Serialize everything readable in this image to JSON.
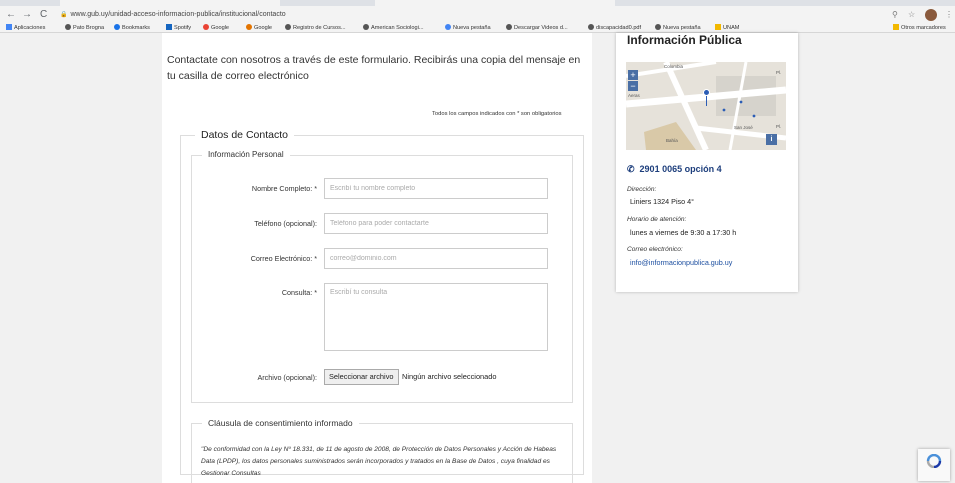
{
  "browser": {
    "url": "www.gub.uy/unidad-acceso-informacion-publica/institucional/contacto",
    "back_icon": "arrow-left-icon",
    "forward_icon": "arrow-right-icon",
    "reload_icon": "reload-icon",
    "bookmarks": [
      "Aplicaciones",
      "Pato Brogna",
      "Bookmarks",
      "Spotify",
      "Google",
      "Google",
      "Registro de Cursos...",
      "American Sociologi...",
      "Nueva pestaña",
      "Descargar Videos d...",
      "discapacidad0.pdf",
      "Nueva pestaña",
      "UNAM"
    ],
    "other_bookmarks": "Otros marcadores"
  },
  "form": {
    "intro": "Contactate con nosotros a través de este formulario. Recibirás una copia del mensaje en tu casilla de correo electrónico",
    "required_note": "Todos los campos indicados con * son obligatorios",
    "section_title": "Datos de Contacto",
    "personal_title": "Información Personal",
    "fields": {
      "name": {
        "label": "Nombre Completo: *",
        "placeholder": "Escribí tu nombre completo"
      },
      "phone": {
        "label": "Teléfono (opcional):",
        "placeholder": "Teléfono para poder contactarte"
      },
      "email": {
        "label": "Correo Electrónico: *",
        "placeholder": "correo@dominio.com"
      },
      "query": {
        "label": "Consulta: *",
        "placeholder": "Escribí tu consulta"
      },
      "file": {
        "label": "Archivo (opcional):",
        "button": "Seleccionar archivo",
        "status": "Ningún archivo seleccionado"
      }
    },
    "clause_title": "Cláusula de consentimiento informado",
    "clause_text": "\"De conformidad con la Ley Nº 18.331, de 11 de agosto de 2008, de Protección de Datos Personales y Acción de Habeas Data (LPDP), los datos personales suministrados serán incorporados y tratados en la Base de Datos , cuya finalidad es Gestionar Consultas"
  },
  "sidebar": {
    "title": "Información Pública",
    "map": {
      "zoom_in": "+",
      "zoom_out": "−",
      "labels": [
        "Colombia",
        "Pl.",
        "Aeras",
        "San José",
        "Pl.",
        "Bahía"
      ],
      "info": "i"
    },
    "phone": "2901 0065 opción 4",
    "address_label": "Dirección:",
    "address": "Liniers 1324 Piso 4°",
    "hours_label": "Horario de atención:",
    "hours": "lunes a viernes de 9:30 a 17:30 h",
    "email_label": "Correo electrónico:",
    "email": "info@informacionpublica.gub.uy"
  },
  "colors": {
    "accent": "#1d3e7c",
    "link": "#1d4fa0",
    "page_bg": "#f1f1f1"
  }
}
